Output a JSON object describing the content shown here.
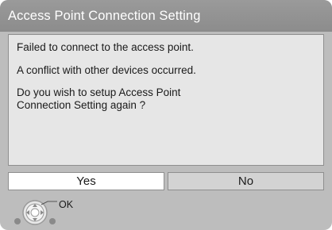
{
  "dialog": {
    "title": "Access Point Connection Setting",
    "messages": [
      "Failed to connect to the access point.",
      "A conflict with other devices occurred.",
      "Do you wish to setup Access Point\nConnection Setting again ?"
    ]
  },
  "buttons": {
    "yes_label": "Yes",
    "no_label": "No",
    "selected": "Yes"
  },
  "help": {
    "ok_label": "OK",
    "icon": "remote-dpad-icon"
  },
  "colors": {
    "title_bar": "#8c8c8c",
    "panel": "#e6e6e6",
    "background": "#bdbdbd",
    "selected_button": "#ffffff",
    "unselected_button": "#d3d3d3"
  }
}
